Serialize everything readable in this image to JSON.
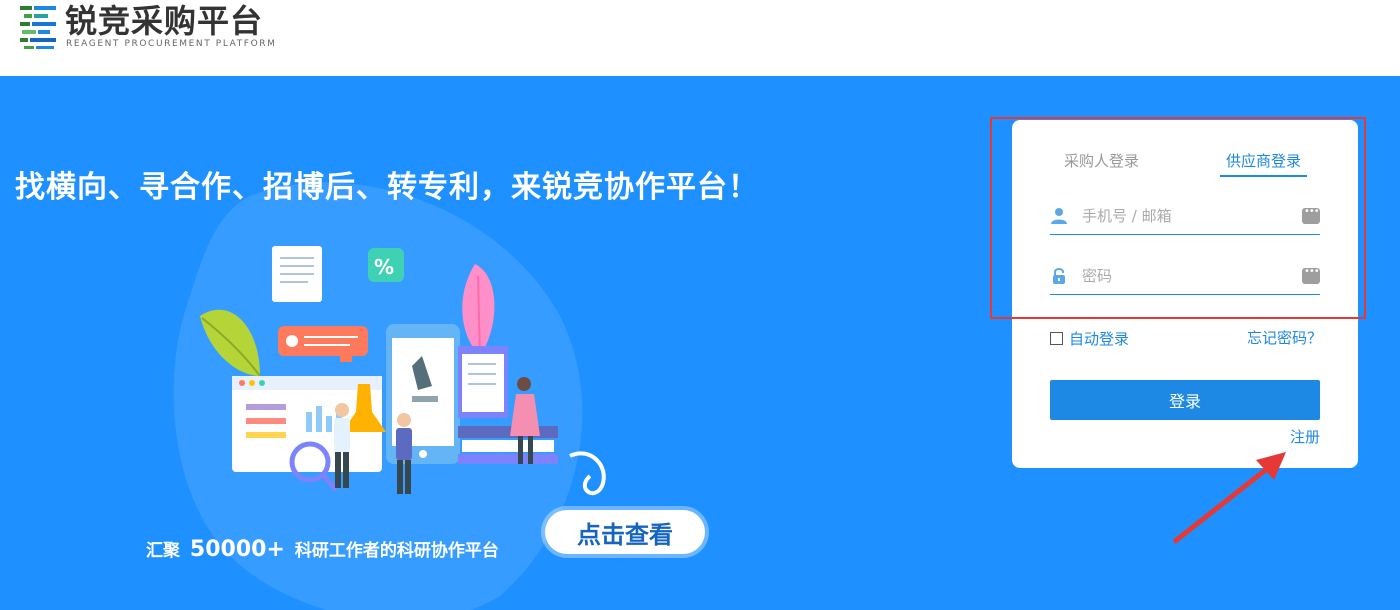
{
  "header": {
    "logo_title": "锐竞采购平台",
    "logo_subtitle": "REAGENT PROCUREMENT PLATFORM"
  },
  "banner": {
    "slogan": "找横向、寻合作、招博后、转专利，来锐竞协作平台！",
    "stat_prefix": "汇聚",
    "stat_number": "50000+",
    "stat_suffix": "科研工作者的科研协作平台",
    "view_button": "点击查看",
    "illustration_badge": "%"
  },
  "login": {
    "tabs": [
      {
        "label": "采购人登录",
        "active": false
      },
      {
        "label": "供应商登录",
        "active": true
      }
    ],
    "phone_placeholder": "手机号 / 邮箱",
    "password_placeholder": "密码",
    "remember_label": "自动登录",
    "forgot_label": "忘记密码？",
    "submit_label": "登录",
    "register_label": "注册"
  },
  "colors": {
    "banner_bg": "#1e90ff",
    "accent": "#1e88e5",
    "highlight": "#e53935"
  }
}
